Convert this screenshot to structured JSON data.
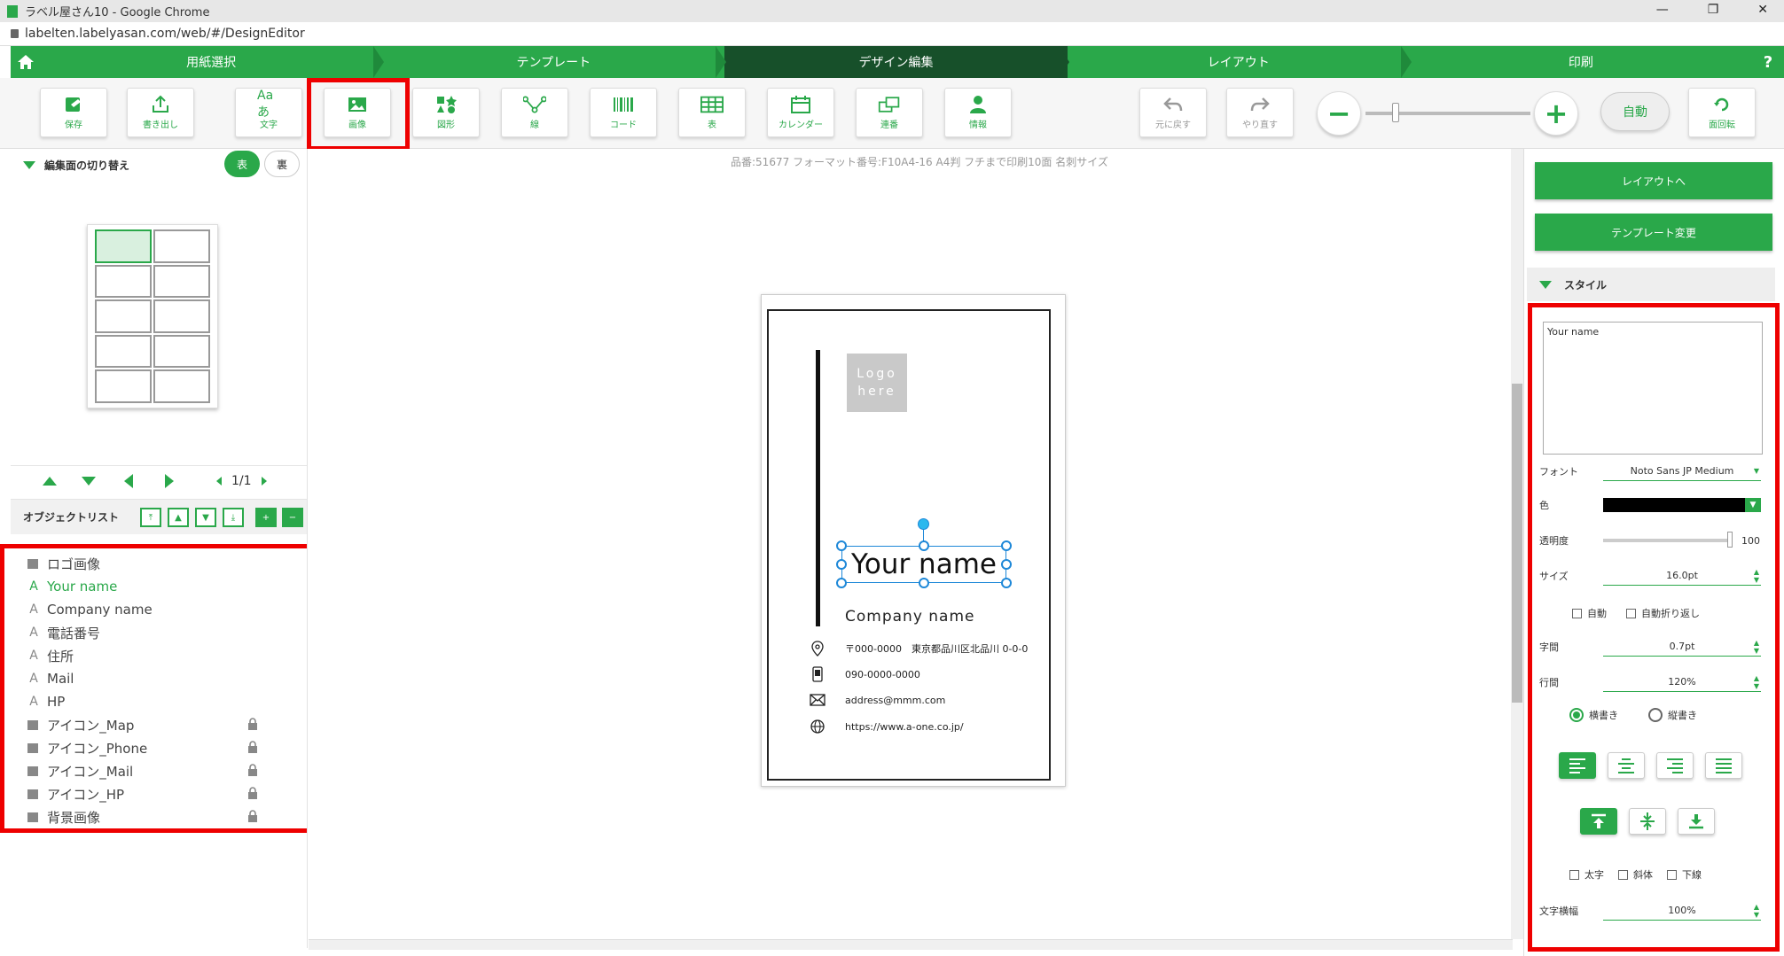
{
  "browser": {
    "title": "ラベル屋さん10 - Google Chrome",
    "url": "labelten.labelyasan.com/web/#/DesignEditor",
    "win_minimize": "—",
    "win_restore": "❐",
    "win_close": "✕"
  },
  "steps": [
    {
      "label": "用紙選択"
    },
    {
      "label": "テンプレート"
    },
    {
      "label": "デザイン編集"
    },
    {
      "label": "レイアウト"
    },
    {
      "label": "印刷"
    }
  ],
  "help_label": "?",
  "toolbar": {
    "save": "保存",
    "export": "書き出し",
    "text": "文字",
    "text_icon": "Aaあ",
    "image": "画像",
    "shape": "図形",
    "line": "線",
    "code": "コード",
    "table": "表",
    "calendar": "カレンダー",
    "serial": "連番",
    "info": "情報",
    "undo": "元に戻す",
    "redo": "やり直す",
    "auto": "自動",
    "rotate": "面回転"
  },
  "left": {
    "face_switch": "編集面の切り替え",
    "front": "表",
    "back": "裏",
    "page": "1/1",
    "object_list_title": "オブジェクトリスト",
    "objects": [
      {
        "name": "ロゴ画像",
        "type": "image",
        "locked": false
      },
      {
        "name": "Your name",
        "type": "text",
        "locked": false
      },
      {
        "name": "Company name",
        "type": "text",
        "locked": false
      },
      {
        "name": "電話番号",
        "type": "text",
        "locked": false
      },
      {
        "name": "住所",
        "type": "text",
        "locked": false
      },
      {
        "name": "Mail",
        "type": "text",
        "locked": false
      },
      {
        "name": "HP",
        "type": "text",
        "locked": false
      },
      {
        "name": "アイコン_Map",
        "type": "image",
        "locked": true
      },
      {
        "name": "アイコン_Phone",
        "type": "image",
        "locked": true
      },
      {
        "name": "アイコン_Mail",
        "type": "image",
        "locked": true
      },
      {
        "name": "アイコン_HP",
        "type": "image",
        "locked": true
      },
      {
        "name": "背景画像",
        "type": "image",
        "locked": true
      }
    ]
  },
  "canvas": {
    "product_info": "品番:51677 フォーマット番号:F10A4-16 A4判 フチまで印刷10面 名刺サイズ",
    "logo_line1": "Logo",
    "logo_line2": "here",
    "your_name": "Your name",
    "company_name": "Company name",
    "address": "〒000-0000　東京都品川区北品川 0-0-0",
    "phone": "090-0000-0000",
    "email": "address@mmm.com",
    "url": "https://www.a-one.co.jp/"
  },
  "right": {
    "to_layout": "レイアウトへ",
    "change_template": "テンプレート変更",
    "style_title": "スタイル",
    "text_value": "Your name",
    "font_label": "フォント",
    "font_value": "Noto Sans JP Medium",
    "color_label": "色",
    "opacity_label": "透明度",
    "opacity_value": "100",
    "size_label": "サイズ",
    "size_value": "16.0pt",
    "auto_label": "自動",
    "autowrap_label": "自動折り返し",
    "letter_spacing_label": "字間",
    "letter_spacing_value": "0.7pt",
    "line_spacing_label": "行間",
    "line_spacing_value": "120%",
    "horizontal_label": "横書き",
    "vertical_label": "縦書き",
    "bold_label": "太字",
    "italic_label": "斜体",
    "underline_label": "下線",
    "char_width_label": "文字横幅",
    "char_width_value": "100%"
  },
  "colors": {
    "accent": "#2aa84a",
    "active_step": "#17502a",
    "highlight": "#ee0000",
    "selection": "#1e88d8"
  }
}
